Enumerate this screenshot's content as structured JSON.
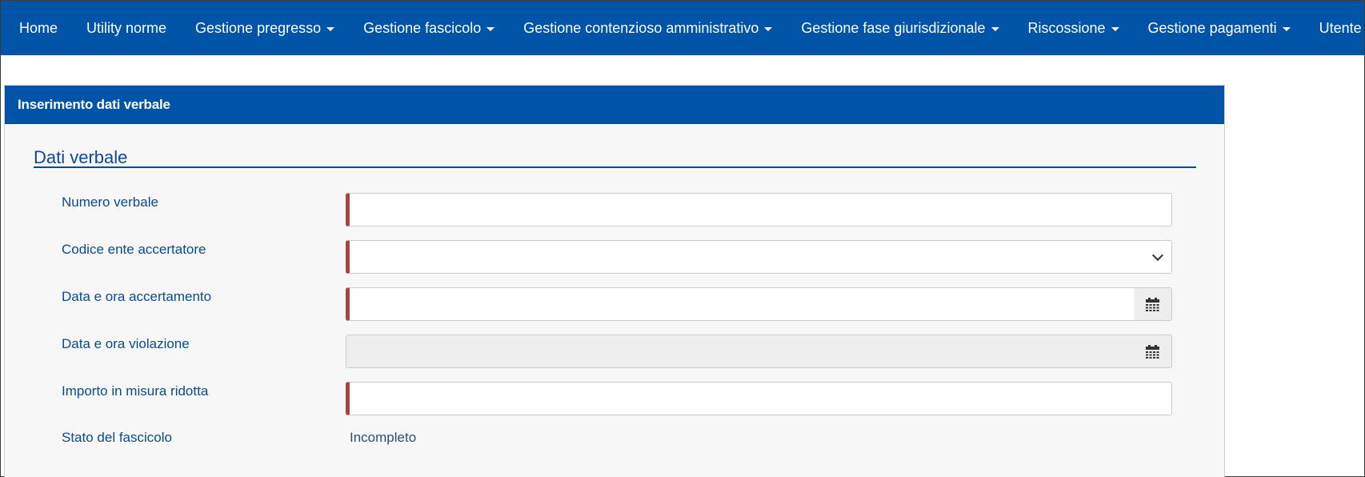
{
  "navbar": {
    "items": [
      {
        "label": "Home",
        "has_caret": false
      },
      {
        "label": "Utility norme",
        "has_caret": false
      },
      {
        "label": "Gestione pregresso",
        "has_caret": true
      },
      {
        "label": "Gestione fascicolo",
        "has_caret": true
      },
      {
        "label": "Gestione contenzioso amministrativo",
        "has_caret": true
      },
      {
        "label": "Gestione fase giurisdizionale",
        "has_caret": true
      },
      {
        "label": "Riscossione",
        "has_caret": true
      },
      {
        "label": "Gestione pagamenti",
        "has_caret": true
      },
      {
        "label": "Utente",
        "has_caret": true
      }
    ]
  },
  "panel": {
    "title": "Inserimento dati verbale",
    "section_title": "Dati verbale",
    "fields": {
      "numero_verbale": {
        "label": "Numero verbale",
        "value": ""
      },
      "codice_ente": {
        "label": "Codice ente accertatore",
        "value": ""
      },
      "data_accertamento": {
        "label": "Data e ora accertamento",
        "value": ""
      },
      "data_violazione": {
        "label": "Data e ora violazione",
        "value": ""
      },
      "importo": {
        "label": "Importo in misura ridotta",
        "value": ""
      },
      "stato": {
        "label": "Stato del fascicolo",
        "value": "Incompleto"
      }
    }
  },
  "colors": {
    "brand_blue": "#0054a8",
    "label_blue": "#0a4b8f",
    "required_marker": "#a94442"
  },
  "icons": {
    "select": "chevron-down-icon",
    "datetime": "calendar-icon"
  }
}
